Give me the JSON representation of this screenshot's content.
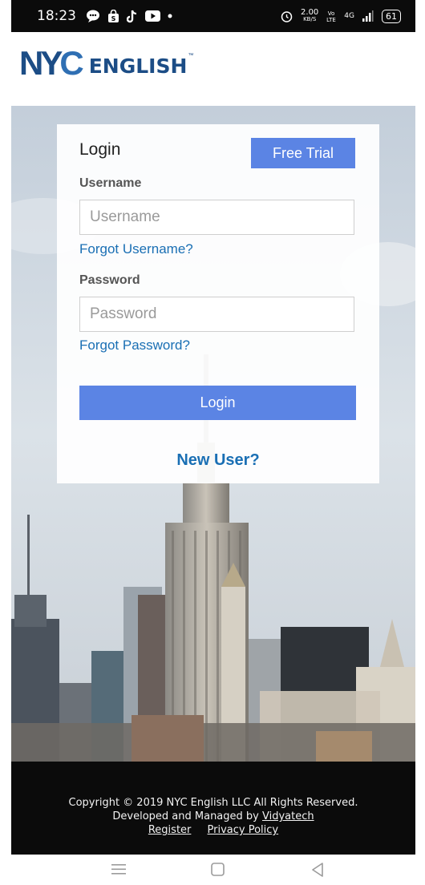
{
  "status_bar": {
    "time": "18:23",
    "speed_value": "2.00",
    "speed_unit": "KB/S",
    "network": "4G",
    "battery": "61"
  },
  "header": {
    "logo_mark": "NYC",
    "logo_word": "ENGLISH",
    "logo_tm": "™"
  },
  "login_card": {
    "title": "Login",
    "free_trial_label": "Free Trial",
    "username_label": "Username",
    "username_placeholder": "Username",
    "username_value": "",
    "forgot_username": "Forgot Username?",
    "password_label": "Password",
    "password_placeholder": "Password",
    "password_value": "",
    "forgot_password": "Forgot Password?",
    "login_button": "Login",
    "new_user": "New User?"
  },
  "footer": {
    "copyright": "Copyright © 2019 NYC English LLC All Rights Reserved.",
    "developed_prefix": "Developed and Managed by ",
    "developer_link": "Vidyatech",
    "register_link": "Register",
    "privacy_link": "Privacy Policy"
  },
  "colors": {
    "accent": "#5b84e4",
    "link": "#1a6fb4",
    "logo_blue": "#1c4d86",
    "footer_bg": "#0b0b0b"
  },
  "icons": [
    "chat-icon",
    "shopping-bag-icon",
    "tiktok-icon",
    "youtube-icon",
    "dot-icon",
    "alarm-icon",
    "volte-icon",
    "signal-icon",
    "battery-icon",
    "menu-icon",
    "home-square-icon",
    "back-triangle-icon"
  ]
}
